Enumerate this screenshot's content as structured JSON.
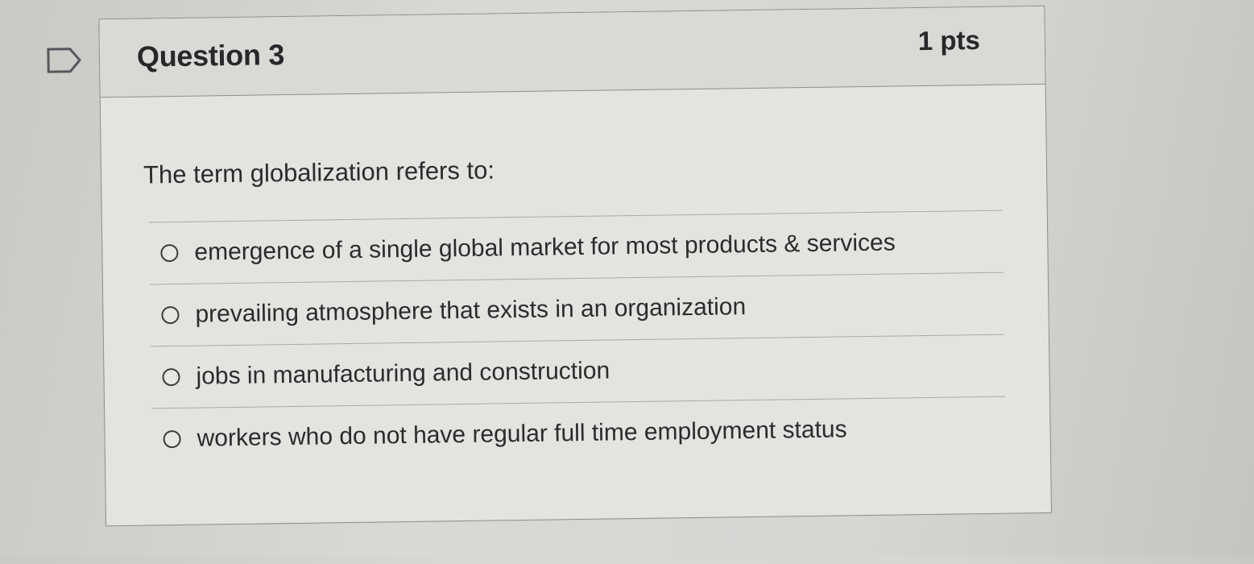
{
  "question": {
    "title": "Question 3",
    "points": "1 pts",
    "prompt": "The term globalization refers to:",
    "flag_icon": "flag-outline-icon",
    "options": [
      {
        "label": "emergence of a single global market for most products & services",
        "selected": false
      },
      {
        "label": "prevailing atmosphere that exists in an organization",
        "selected": false
      },
      {
        "label": "jobs in manufacturing and construction",
        "selected": false
      },
      {
        "label": "workers who do not have regular full time employment status",
        "selected": false
      }
    ]
  },
  "colors": {
    "background": "#d3d3d0",
    "card": "#e3e3e0",
    "header": "#d9d9d6",
    "border": "#8e8f8c",
    "text": "#2a2c2d"
  }
}
